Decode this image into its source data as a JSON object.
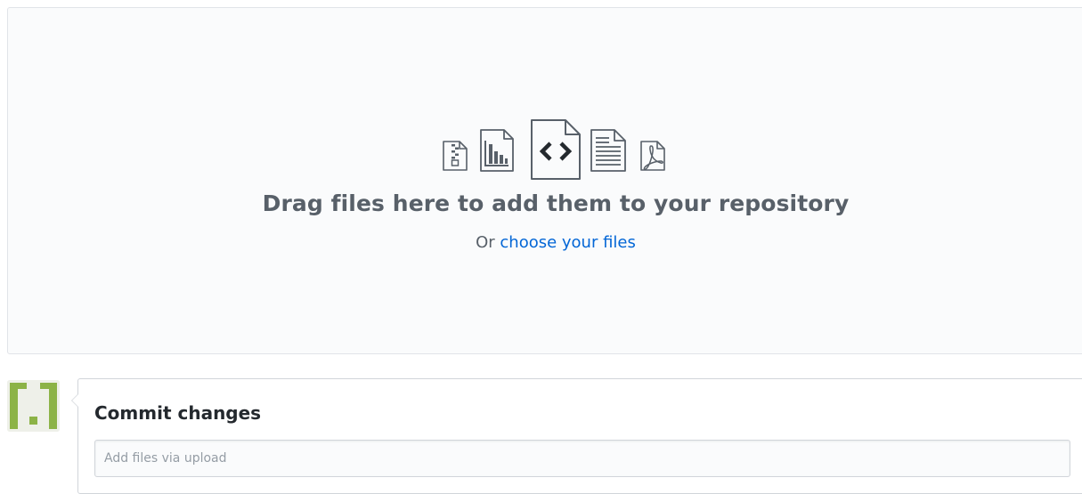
{
  "dropzone": {
    "icons": [
      "file-zip-icon",
      "file-chart-icon",
      "file-code-icon",
      "file-text-icon",
      "file-pdf-icon"
    ],
    "title": "Drag files here to add them to your repository",
    "or_text": "Or ",
    "choose_link": "choose your files"
  },
  "commit": {
    "title": "Commit changes",
    "message_placeholder": "Add files via upload",
    "message_value": ""
  },
  "colors": {
    "link": "#0366d6",
    "muted_text": "#586069",
    "avatar_green": "#8cb347"
  }
}
